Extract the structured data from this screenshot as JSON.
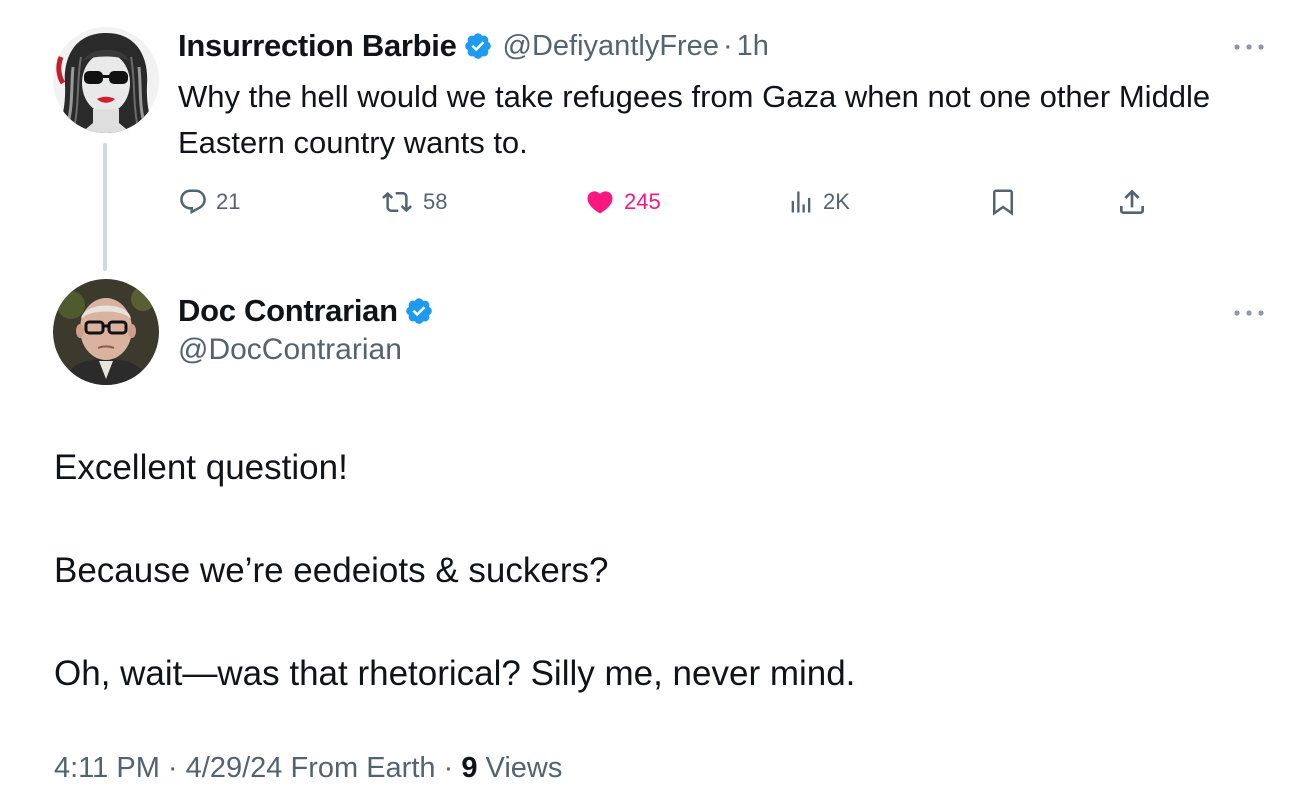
{
  "parent_tweet": {
    "author_name": "Insurrection Barbie",
    "handle": "@DefiyantlyFree",
    "separator": "·",
    "time": "1h",
    "text": "Why the hell would we take refugees from Gaza when not one other Middle Eastern country wants to.",
    "actions": {
      "reply_count": "21",
      "repost_count": "58",
      "like_count": "245",
      "view_count": "2K"
    },
    "verified": true
  },
  "reply_tweet": {
    "author_name": "Doc Contrarian",
    "handle": "@DocContrarian",
    "verified": true,
    "paragraphs": [
      "Excellent question!",
      "Because we’re eedeiots & suckers?",
      "Oh, wait—was that rhetorical? Silly me, never mind."
    ],
    "meta": {
      "time": "4:11 PM",
      "sep1": "·",
      "date": "4/29/24",
      "source": "From Earth",
      "sep2": "·",
      "views_count": "9",
      "views_label": "Views"
    }
  },
  "colors": {
    "text": "#0f1419",
    "secondary": "#536471",
    "verified_blue": "#1d9bf0",
    "like_pink": "#f91880",
    "thread_line": "#cfd9de"
  },
  "icons": {
    "reply": "reply-icon",
    "repost": "repost-icon",
    "like": "heart-filled-icon",
    "views": "views-icon",
    "bookmark": "bookmark-icon",
    "share": "share-icon",
    "more": "more-options-icon",
    "verified": "verified-badge-icon"
  }
}
